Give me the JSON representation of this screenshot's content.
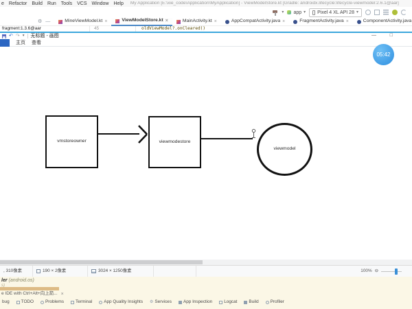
{
  "window": {
    "title": "My Application [E:\\xie_code\\Application\\MyApplication] - ViewModelStore.kt [Gradle: androidx.lifecycle:lifecycle-viewmodel:2.6.1@aar]"
  },
  "menu": {
    "items": [
      "e",
      "Refactor",
      "Build",
      "Run",
      "Tools",
      "VCS",
      "Window",
      "Help"
    ]
  },
  "run_toolbar": {
    "config_label": "app",
    "device_label": "Pixel 4 XL API 28"
  },
  "editor": {
    "tabs": [
      {
        "label": "MineViewModel.kt",
        "close": "×"
      },
      {
        "label": "ViewModelStore.kt",
        "close": "×"
      },
      {
        "label": "MainActivity.kt",
        "close": "×"
      },
      {
        "label": "AppCompatActivity.java",
        "close": "×"
      },
      {
        "label": "FragmentActivity.java",
        "close": "×"
      },
      {
        "label": "ComponentActivity.java",
        "close": "×"
      }
    ],
    "project_item": "fragment:1.3.6@aar",
    "line_number": "45",
    "code_line": "oldViewModel?.onCleared()"
  },
  "paint": {
    "title": "无标题 - 画图",
    "ribbon_tabs": [
      "主页",
      "查看"
    ],
    "status": {
      "cursor": ", 310像素",
      "selection": "190 × 2像素",
      "image_size": "3024 × 1250像素",
      "zoom": "100%"
    }
  },
  "diagram": {
    "nodes": [
      {
        "shape": "rect",
        "label": "vmstoreowner"
      },
      {
        "shape": "rect",
        "label": "viewmodestore"
      },
      {
        "shape": "circle",
        "label": "viewmodel"
      }
    ]
  },
  "overlay": {
    "timer": "05:42"
  },
  "doc_popup": {
    "title": "ler",
    "package": "(android.os)",
    "line2": "s)"
  },
  "notification": {
    "text": "e IDE with Ctrl+Alt+向上箭...",
    "close": "×"
  },
  "tool_window_bar": {
    "items": [
      "bug",
      "TODO",
      "Problems",
      "Terminal",
      "App Quality Insights",
      "Services",
      "App Inspection",
      "Logcat",
      "Build",
      "Profiler"
    ]
  },
  "icons": {
    "undo": "↶",
    "redo": "↷",
    "dropdown": "▾",
    "minimize": "—",
    "maximize": "□",
    "zoom_out": "⊖"
  },
  "colors": {
    "accent_blue": "#2b66c2",
    "bubble_blue": "#3f9bea",
    "divider_blue": "#3aa6dc",
    "cream": "#fbf7e6"
  }
}
